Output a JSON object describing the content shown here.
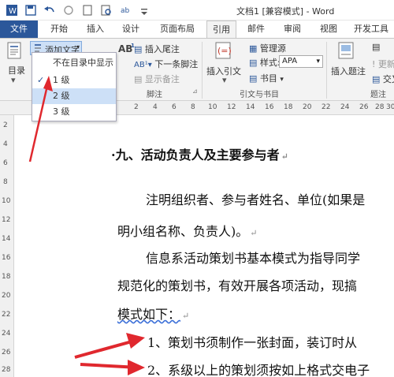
{
  "window": {
    "title": "文档1 [兼容模式] - Word"
  },
  "tabs": [
    {
      "label": "文件"
    },
    {
      "label": "开始"
    },
    {
      "label": "插入"
    },
    {
      "label": "设计"
    },
    {
      "label": "页面布局"
    },
    {
      "label": "引用"
    },
    {
      "label": "邮件"
    },
    {
      "label": "审阅"
    },
    {
      "label": "视图"
    },
    {
      "label": "开发工具"
    }
  ],
  "ribbon": {
    "toc_label": "目录",
    "add_text_label": "添加文字",
    "insert_endnote_label": "插入尾注",
    "next_footnote_label": "下一条脚注",
    "show_notes_label": "显示备注",
    "footnote_group_label": "脚注",
    "insert_citation_label": "插入引文",
    "manage_sources_label": "管理源",
    "style_label": "样式:",
    "style_value": "APA",
    "bibliography_label": "书目",
    "citations_group_label": "引文与书目",
    "insert_caption_label": "插入题注",
    "update_table_label": "更新",
    "cross_ref_label": "交叉",
    "caption_group_label": "题注"
  },
  "dropdown": {
    "items": [
      {
        "label": "不在目录中显示"
      },
      {
        "label": "1 级",
        "checked": "✓"
      },
      {
        "label": "2 级"
      },
      {
        "label": "3 级"
      }
    ]
  },
  "ruler": {
    "h_ticks": [
      "2",
      "4",
      "6",
      "8",
      "10",
      "12",
      "14",
      "16",
      "18",
      "20",
      "22",
      "24",
      "26",
      "28",
      "30"
    ],
    "v_ticks": [
      "2",
      "4",
      "6",
      "8",
      "10",
      "12",
      "14",
      "16",
      "18",
      "20",
      "22",
      "24",
      "26",
      "28"
    ]
  },
  "document": {
    "heading": "·九、活动负责人及主要参与者",
    "lines": [
      "注明组织者、参与者姓名、单位(如果是",
      "明小组名称、负责人)。",
      "信息系活动策划书基本模式为指导同学",
      "规范化的策划书，有效开展各项活动，现搞",
      "模式如下：",
      "1、策划书须制作一张封面，装订时从",
      "2、系级以上的策划须按如上格式交电子"
    ]
  },
  "colors": {
    "accent": "#2b579a",
    "arrow": "#e0282e",
    "hover": "#cde0f7"
  }
}
